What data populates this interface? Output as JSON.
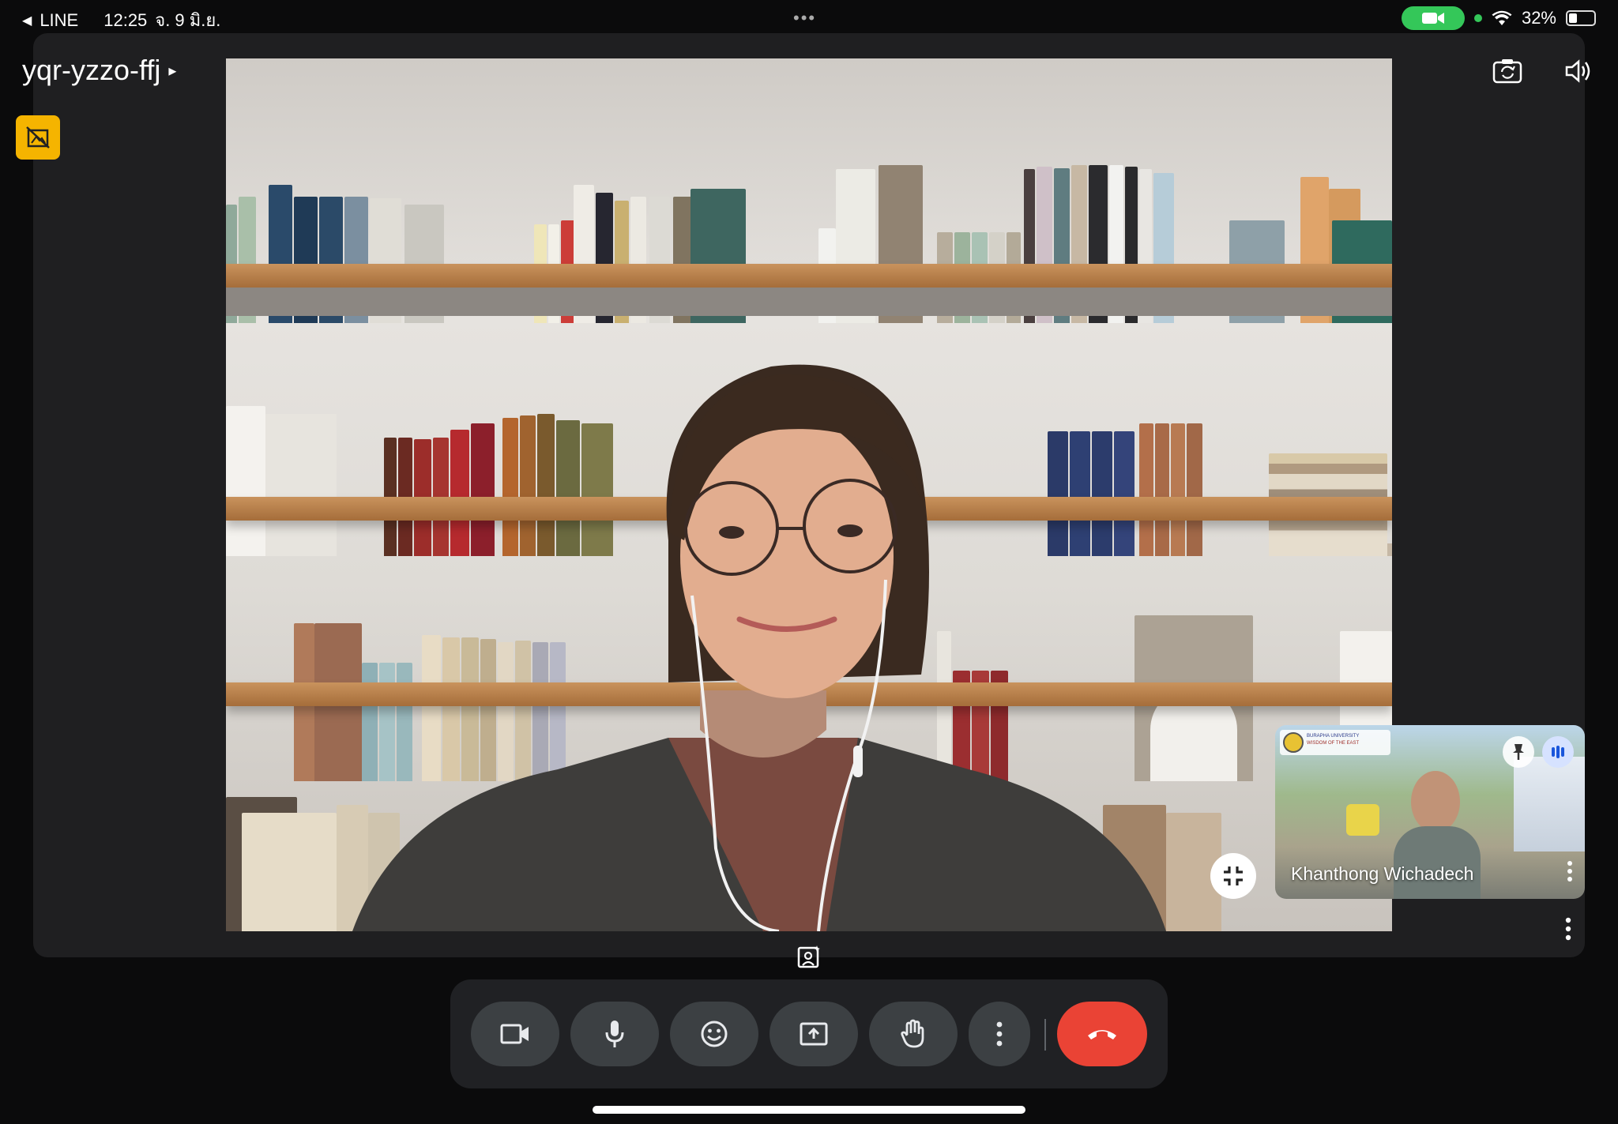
{
  "status_bar": {
    "back_app": "LINE",
    "time": "12:25",
    "date": "จ. 9 มิ.ย.",
    "more_dots": "•••",
    "battery_text": "32%",
    "battery_level": 0.32,
    "camera_indicator_color": "#34c759"
  },
  "meeting": {
    "code": "yqr-yzzo-ffj",
    "code_caret": "▸"
  },
  "icons": {
    "badge": "no-photography-icon",
    "switch_camera": "flip-camera-icon",
    "speaker": "speaker-icon",
    "exit_fullscreen": "fullscreen-exit-icon",
    "effects": "portrait-effects-icon"
  },
  "participant": {
    "name": "Khanthong Wichadech",
    "thumb_banner_line1": "BURAPHA UNIVERSITY",
    "thumb_banner_line2": "WISDOM OF THE EAST"
  },
  "controls": {
    "camera": "videocam-icon",
    "mic": "mic-icon",
    "reactions": "emoji-icon",
    "present": "present-screen-icon",
    "raise_hand": "raise-hand-icon",
    "more": "more-vertical-icon",
    "end_call": "end-call-icon",
    "end_call_color": "#ea4335"
  }
}
